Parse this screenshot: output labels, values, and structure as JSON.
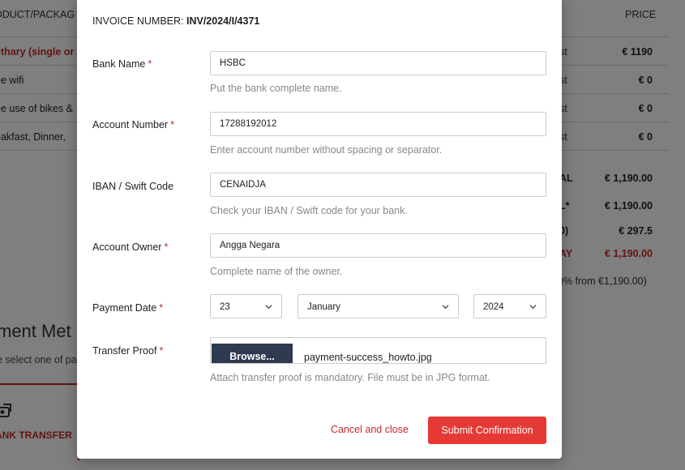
{
  "background": {
    "table": {
      "col_product": "ODUCT/PACKAG",
      "col_price": "PRICE",
      "rows": [
        {
          "name": "ethary (single or",
          "type": "st",
          "price": "€ 1190"
        },
        {
          "name": "ee wifi",
          "type": "st",
          "price": "€ 0"
        },
        {
          "name": "ee use of bikes &",
          "type": "st",
          "price": "€ 0"
        },
        {
          "name": "eakfast, Dinner,",
          "type": "st",
          "price": "€ 0"
        }
      ]
    },
    "summary": {
      "total_label": "AL",
      "total_value": "€ 1,190.00",
      "subtotal_label": "L*",
      "subtotal_value": "€ 1,190.00",
      "tax_label": "0)",
      "tax_value": "€ 297.5",
      "pay_label": "AY",
      "pay_value": "€ 1,190.00",
      "note": "0% from €1,190.00)"
    },
    "payment_method": {
      "title": "ment Met",
      "subtitle": "e select one of pa",
      "bank_label": "ANK TRANSFER"
    }
  },
  "modal": {
    "invoice_label": "INVOICE NUMBER:",
    "invoice_number": "INV/2024/I/4371",
    "required_mark": "*",
    "bank_name": {
      "label": "Bank Name",
      "value": "HSBC",
      "help": "Put the bank complete name."
    },
    "account_number": {
      "label": "Account Number",
      "value": "17288192012",
      "help": "Enter account number without spacing or separator."
    },
    "iban": {
      "label": "IBAN / Swift Code",
      "value": "CENAIDJA",
      "help": "Check your IBAN / Swift code for your bank."
    },
    "account_owner": {
      "label": "Account Owner",
      "value": "Angga Negara",
      "help": "Complete name of the owner."
    },
    "payment_date": {
      "label": "Payment Date",
      "day": "23",
      "month": "January",
      "year": "2024"
    },
    "transfer_proof": {
      "label": "Transfer Proof",
      "browse_label": "Browse...",
      "file_name": "payment-success_howto.jpg",
      "help": "Attach transfer proof is mandatory. File must be in JPG format."
    },
    "cancel_label": "Cancel and close",
    "submit_label": "Submit Confirmation"
  },
  "colors": {
    "accent_red": "#e53935",
    "link_red": "#c62828",
    "browse_bg": "#2d3a4f"
  },
  "icons": [
    "chevron-down-icon",
    "bank-transfer-icon"
  ]
}
